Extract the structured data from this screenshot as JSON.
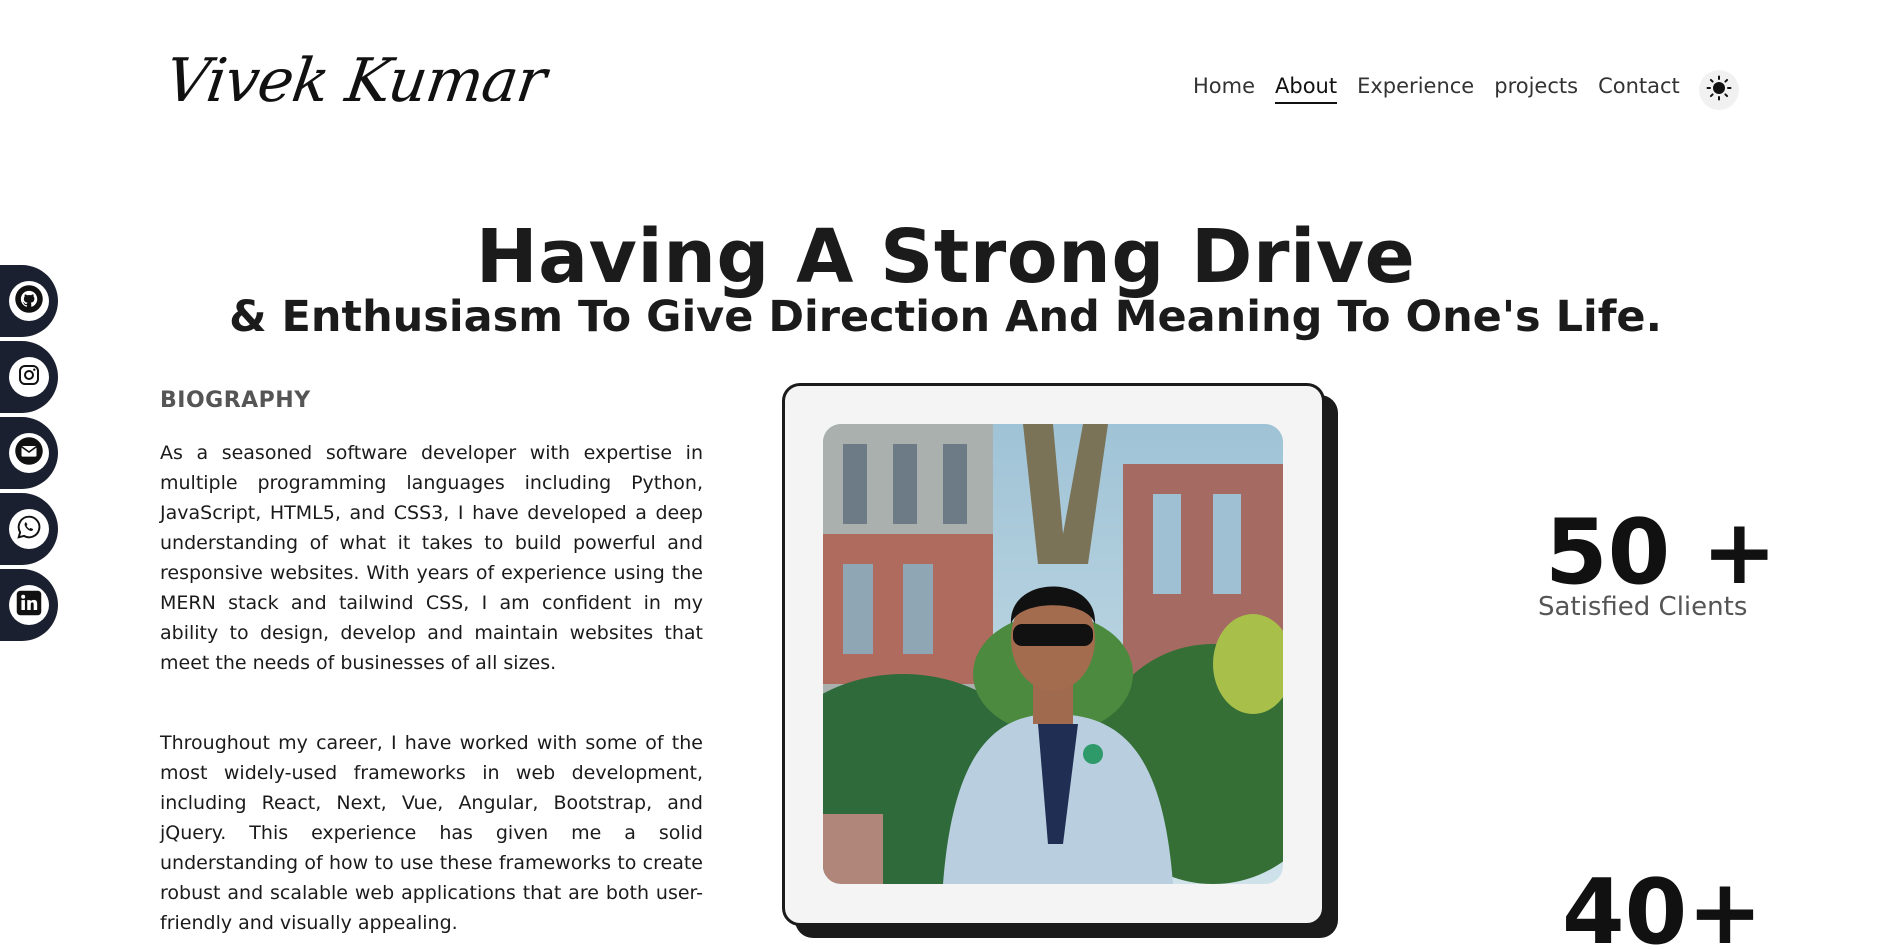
{
  "brand": {
    "name": "Vivek Kumar"
  },
  "nav": {
    "items": [
      {
        "label": "Home"
      },
      {
        "label": "About"
      },
      {
        "label": "Experience"
      },
      {
        "label": "projects"
      },
      {
        "label": "Contact"
      }
    ],
    "active": "About",
    "theme_toggle_icon": "sun-icon"
  },
  "social": [
    {
      "icon": "github-icon"
    },
    {
      "icon": "instagram-icon"
    },
    {
      "icon": "mail-icon"
    },
    {
      "icon": "whatsapp-icon"
    },
    {
      "icon": "linkedin-icon"
    }
  ],
  "hero": {
    "title": "Having A Strong Drive",
    "subtitle": "& Enthusiasm To Give Direction And Meaning To One's Life."
  },
  "biography": {
    "heading": "BIOGRAPHY",
    "paragraph1": "As a seasoned software developer with expertise in multiple programming languages including Python, JavaScript, HTML5, and CSS3, I have developed a deep understanding of what it takes to build powerful and responsive websites. With years of experience using the MERN stack and tailwind CSS, I am confident in my ability to design, develop and maintain websites that meet the needs of businesses of all sizes.",
    "paragraph2": "Throughout my career, I have worked with some of the most widely-used frameworks in web development, including React, Next, Vue, Angular, Bootstrap, and jQuery. This experience has given me a solid understanding of how to use these frameworks to create robust and scalable web applications that are both user-friendly and visually appealing."
  },
  "stats": [
    {
      "value": "50 +",
      "label": "Satisfied Clients"
    },
    {
      "value": "40+",
      "label": ""
    }
  ],
  "colors": {
    "social_bg": "#1b2030",
    "text": "#1b1b1b",
    "muted": "#555555"
  }
}
